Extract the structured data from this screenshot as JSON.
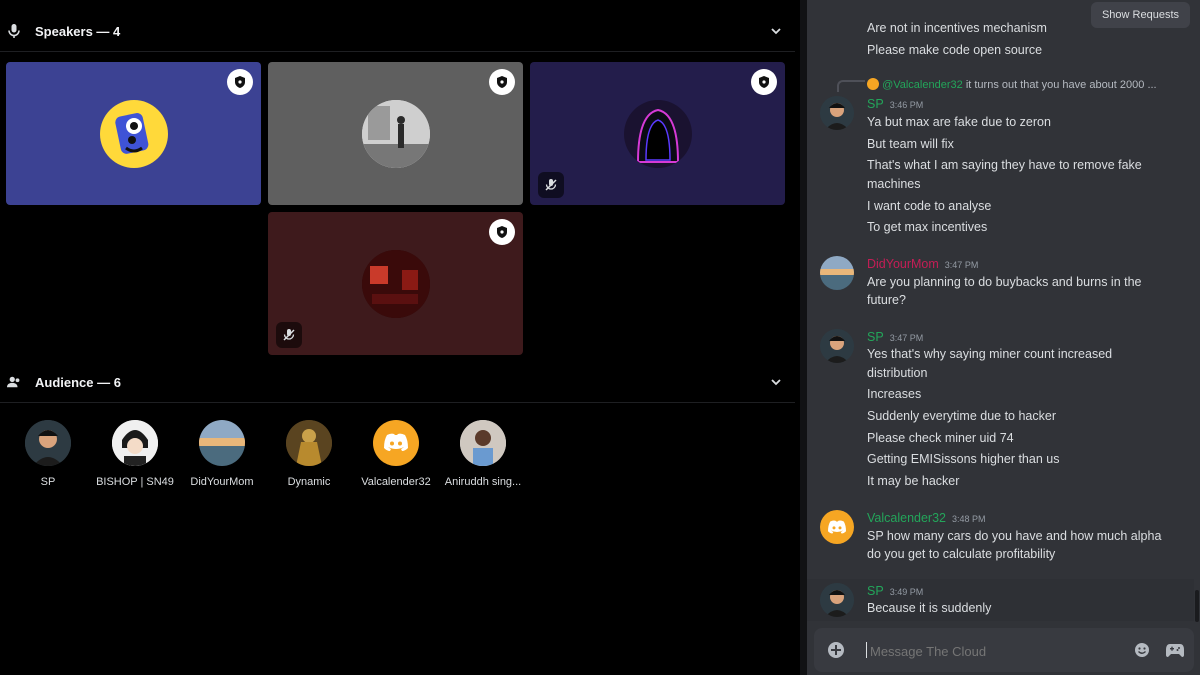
{
  "speakers": {
    "title": "Speakers — 4"
  },
  "audience": {
    "title": "Audience — 6",
    "members": [
      {
        "name": "SP"
      },
      {
        "name": "BISHOP | SN49"
      },
      {
        "name": "DidYourMom"
      },
      {
        "name": "Dynamic"
      },
      {
        "name": "Valcalender32"
      },
      {
        "name": "Aniruddh sing..."
      }
    ]
  },
  "chat": {
    "show_requests": "Show Requests",
    "top_lines": [
      "Are not in incentives mechanism",
      "Please make code open source"
    ],
    "reply": {
      "mention": "@Valcalender32",
      "text": "it turns out that you have about 2000 ..."
    },
    "messages": [
      {
        "user": "SP",
        "time": "3:46 PM",
        "lines": [
          "Ya but max are fake due to zeron",
          "But team will fix",
          "That's what I am saying they have to remove fake",
          "machines",
          "I want code to analyse",
          "To get max incentives"
        ]
      },
      {
        "user": "DidYourMom",
        "time": "3:47 PM",
        "lines": [
          "Are you planning to do buybacks and burns in the",
          "future?"
        ]
      },
      {
        "user": "SP",
        "time": "3:47 PM",
        "lines": [
          "Yes that's why saying miner count increased",
          "distribution",
          "Increases",
          "Suddenly everytime due to hacker",
          "Please check miner uid 74",
          "Getting EMISissons higher than us",
          "It may be hacker"
        ]
      },
      {
        "user": "Valcalender32",
        "time": "3:48 PM",
        "lines": [
          "SP how many cars do you have and how much alpha",
          "do you get to calculate profitability"
        ]
      },
      {
        "user": "SP",
        "time": "3:49 PM",
        "lines": [
          "Because it is suddenly"
        ]
      }
    ],
    "composer_placeholder": "Message The Cloud"
  },
  "colors": {
    "sp": "#23a55a",
    "didyourmom": "#c41e56",
    "valcalender": "#23a55a",
    "accent_orange": "#f6a623"
  }
}
